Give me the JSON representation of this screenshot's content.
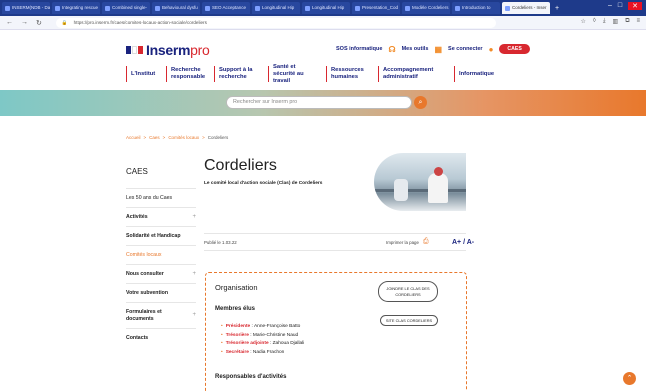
{
  "browser": {
    "tabs": [
      {
        "label": "INSERM(NDB - Dash"
      },
      {
        "label": "Integrating rescue"
      },
      {
        "label": "Combined single-"
      },
      {
        "label": "Behavioural dysfu"
      },
      {
        "label": "SEO Acceptance"
      },
      {
        "label": "Longitudinal Hip"
      },
      {
        "label": "Longitudinal Hip"
      },
      {
        "label": "Presentation_Cod"
      },
      {
        "label": "Modèle Cordeliers"
      },
      {
        "label": "Introduction to"
      },
      {
        "label": "Cordeliers - Inser",
        "active": true
      }
    ],
    "url": "https://pro.inserm.fr/caes/comites-locaux-action-sociale/cordeliers",
    "new_tab": "+"
  },
  "site": {
    "logo_main": "Inserm",
    "logo_suffix": "pro",
    "tools": {
      "sos": "SOS informatique",
      "outils": "Mes outils",
      "login": "Se connecter",
      "caes": "CAES"
    },
    "menu": [
      "L'Institut",
      "Recherche responsable",
      "Support à la recherche",
      "Santé et sécurité au travail",
      "Ressources humaines",
      "Accompagnement administratif",
      "Informatique"
    ],
    "search_placeholder": "Rechercher sur Inserm pro",
    "breadcrumb": [
      "Accueil",
      "Caes",
      "Comités locaux",
      "Cordeliers"
    ],
    "sidebar": {
      "title": "CAES",
      "items": [
        {
          "label": "Les 50 ans du Caes",
          "plus": ""
        },
        {
          "label": "Activités",
          "plus": "+"
        },
        {
          "label": "Solidarité et Handicap",
          "plus": ""
        },
        {
          "label": "Comités locaux",
          "plus": ""
        },
        {
          "label": "Nous consulter",
          "plus": "+"
        },
        {
          "label": "Votre subvention",
          "plus": ""
        },
        {
          "label": "Formulaires et documents",
          "plus": "+"
        },
        {
          "label": "Contacts",
          "plus": ""
        }
      ]
    },
    "page": {
      "title": "Cordeliers",
      "subtitle": "Le comité local d'action sociale (Clas) de Cordeliers",
      "published": "Publié le 1.03.22",
      "print": "Imprimer la page",
      "font_size": "A+ / A-",
      "card": {
        "heading": "Organisation",
        "join_btn": "JOINDRE LE CLAS DES CORDELIERS",
        "site_btn": "SITE CLAS CORDELIERS",
        "members_heading": "Membres élus",
        "members": [
          {
            "role": "Présidente",
            "name": "Anne-Françoise Batto"
          },
          {
            "role": "Trésorière",
            "name": "Marie-Christine Naud"
          },
          {
            "role": "Trésorière adjointe",
            "name": "Zahoua Djallali"
          },
          {
            "role": "Secrétaire",
            "name": "Nadia Frachon"
          }
        ],
        "resp_heading": "Responsables d'activités"
      }
    }
  },
  "colors": {
    "navy": "#1a237e",
    "red": "#d8282f",
    "orange": "#e8782c"
  }
}
